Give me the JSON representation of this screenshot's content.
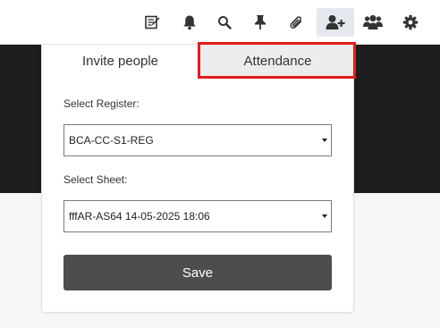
{
  "toolbar": {
    "icons": [
      "notes-icon",
      "bell-icon",
      "search-icon",
      "pin-icon",
      "paperclip-icon",
      "add-user-icon",
      "users-icon",
      "gear-icon"
    ],
    "active_icon": "add-user-icon"
  },
  "tabs": [
    {
      "label": "Invite people",
      "selected": false
    },
    {
      "label": "Attendance",
      "selected": true
    }
  ],
  "form": {
    "register_label": "Select Register:",
    "register_value": "BCA-CC-S1-REG",
    "sheet_label": "Select Sheet:",
    "sheet_value": "fffAR-AS64 14-05-2025 18:06",
    "save_label": "Save"
  },
  "colors": {
    "highlight": "#e21b1b",
    "save_button": "#4d4d4d",
    "dark_band": "#1d1d1d"
  }
}
